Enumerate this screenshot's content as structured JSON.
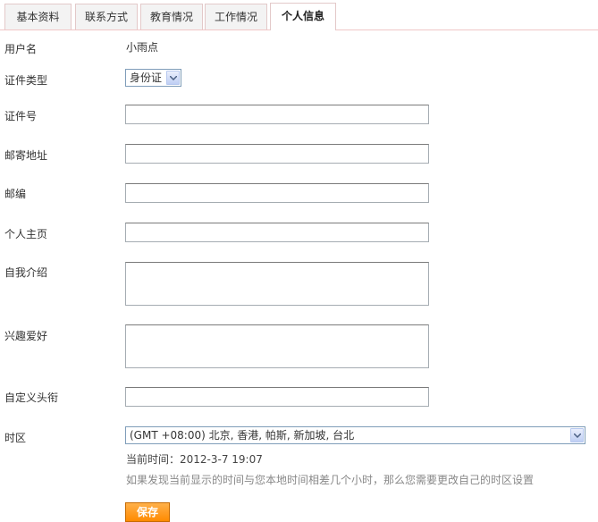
{
  "tabs": [
    {
      "label": "基本资料",
      "active": false
    },
    {
      "label": "联系方式",
      "active": false
    },
    {
      "label": "教育情况",
      "active": false
    },
    {
      "label": "工作情况",
      "active": false
    },
    {
      "label": "个人信息",
      "active": true
    }
  ],
  "form": {
    "username": {
      "label": "用户名",
      "value": "小雨点"
    },
    "id_type": {
      "label": "证件类型",
      "value": "身份证"
    },
    "id_number": {
      "label": "证件号",
      "value": ""
    },
    "address": {
      "label": "邮寄地址",
      "value": ""
    },
    "zipcode": {
      "label": "邮编",
      "value": ""
    },
    "homepage": {
      "label": "个人主页",
      "value": ""
    },
    "bio": {
      "label": "自我介绍",
      "value": ""
    },
    "hobbies": {
      "label": "兴趣爱好",
      "value": ""
    },
    "custom_title": {
      "label": "自定义头衔",
      "value": ""
    },
    "timezone": {
      "label": "时区",
      "value": "(GMT +08:00) 北京, 香港, 帕斯, 新加坡, 台北",
      "current_time": "当前时间：2012-3-7 19:07",
      "note": "如果发现当前显示的时间与您本地时间相差几个小时，那么您需要更改自己的时区设置"
    }
  },
  "actions": {
    "save_label": "保存"
  },
  "colors": {
    "tab_border": "#e3c9c9",
    "tab_bg": "#f3f3f3",
    "note_text": "#888888",
    "save_button": "#ff8a00"
  }
}
